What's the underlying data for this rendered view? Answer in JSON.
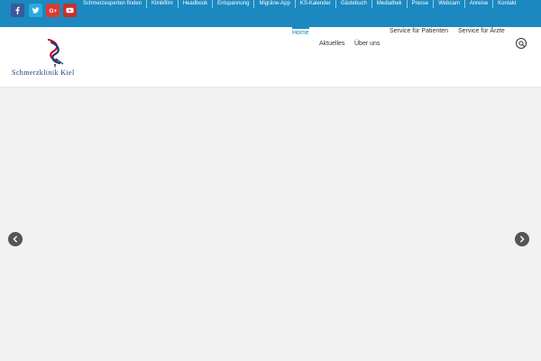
{
  "colors": {
    "topbar": "#1b88c0",
    "accent": "#1b88c0",
    "facebook": "#3b5998",
    "twitter": "#2aa9e0",
    "googleplus": "#d73d32",
    "youtube": "#c4302b",
    "logo_text": "#1a3f74",
    "slider_bg": "#f2f2f2",
    "arrow_bg": "#555555"
  },
  "social": [
    {
      "icon": "facebook-icon"
    },
    {
      "icon": "twitter-icon"
    },
    {
      "icon": "google-plus-icon"
    },
    {
      "icon": "youtube-icon"
    }
  ],
  "topnav": {
    "items": [
      "Schmerzexperten finden",
      "Klinikfilm",
      "Headbook",
      "Entspannung",
      "Migräne-App",
      "KS-Kalender",
      "Gästebuch",
      "Mediathek",
      "Presse",
      "Webcam",
      "Anreise",
      "Kontakt"
    ]
  },
  "logo": {
    "text": "Schmerzklinik Kiel"
  },
  "mainnav": {
    "home": "Home",
    "service_patienten": "Service für Patienten",
    "service_aerzte": "Service für Ärzte",
    "aktuelles": "Aktuelles",
    "ueber_uns": "Über uns",
    "active": "Home"
  },
  "icons": {
    "search": "search-icon",
    "prev": "chevron-left-icon",
    "next": "chevron-right-icon"
  }
}
